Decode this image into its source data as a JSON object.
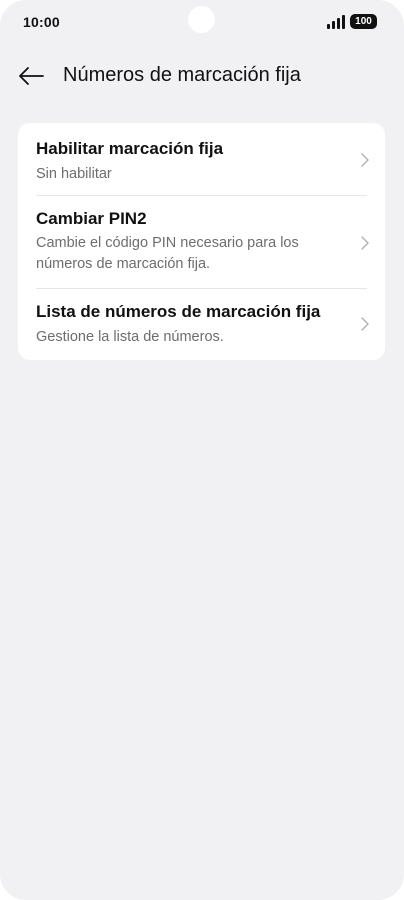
{
  "status_bar": {
    "time": "10:00",
    "battery": "100",
    "signal_icon": "signal-bars-icon"
  },
  "header": {
    "back_icon": "arrow-left-icon",
    "title": "Números de marcación fija"
  },
  "settings": {
    "items": [
      {
        "title": "Habilitar marcación fija",
        "subtitle": "Sin habilitar",
        "icon": "chevron-right-icon"
      },
      {
        "title": "Cambiar PIN2",
        "subtitle": "Cambie el código PIN necesario para los números de marcación fija.",
        "icon": "chevron-right-icon"
      },
      {
        "title": "Lista de números de marcación fija",
        "subtitle": "Gestione la lista de números.",
        "icon": "chevron-right-icon"
      }
    ]
  },
  "colors": {
    "background": "#f1f1f3",
    "card": "#ffffff",
    "text_primary": "#111111",
    "text_secondary": "#6d6d6d",
    "chevron": "#b0b0b0"
  }
}
